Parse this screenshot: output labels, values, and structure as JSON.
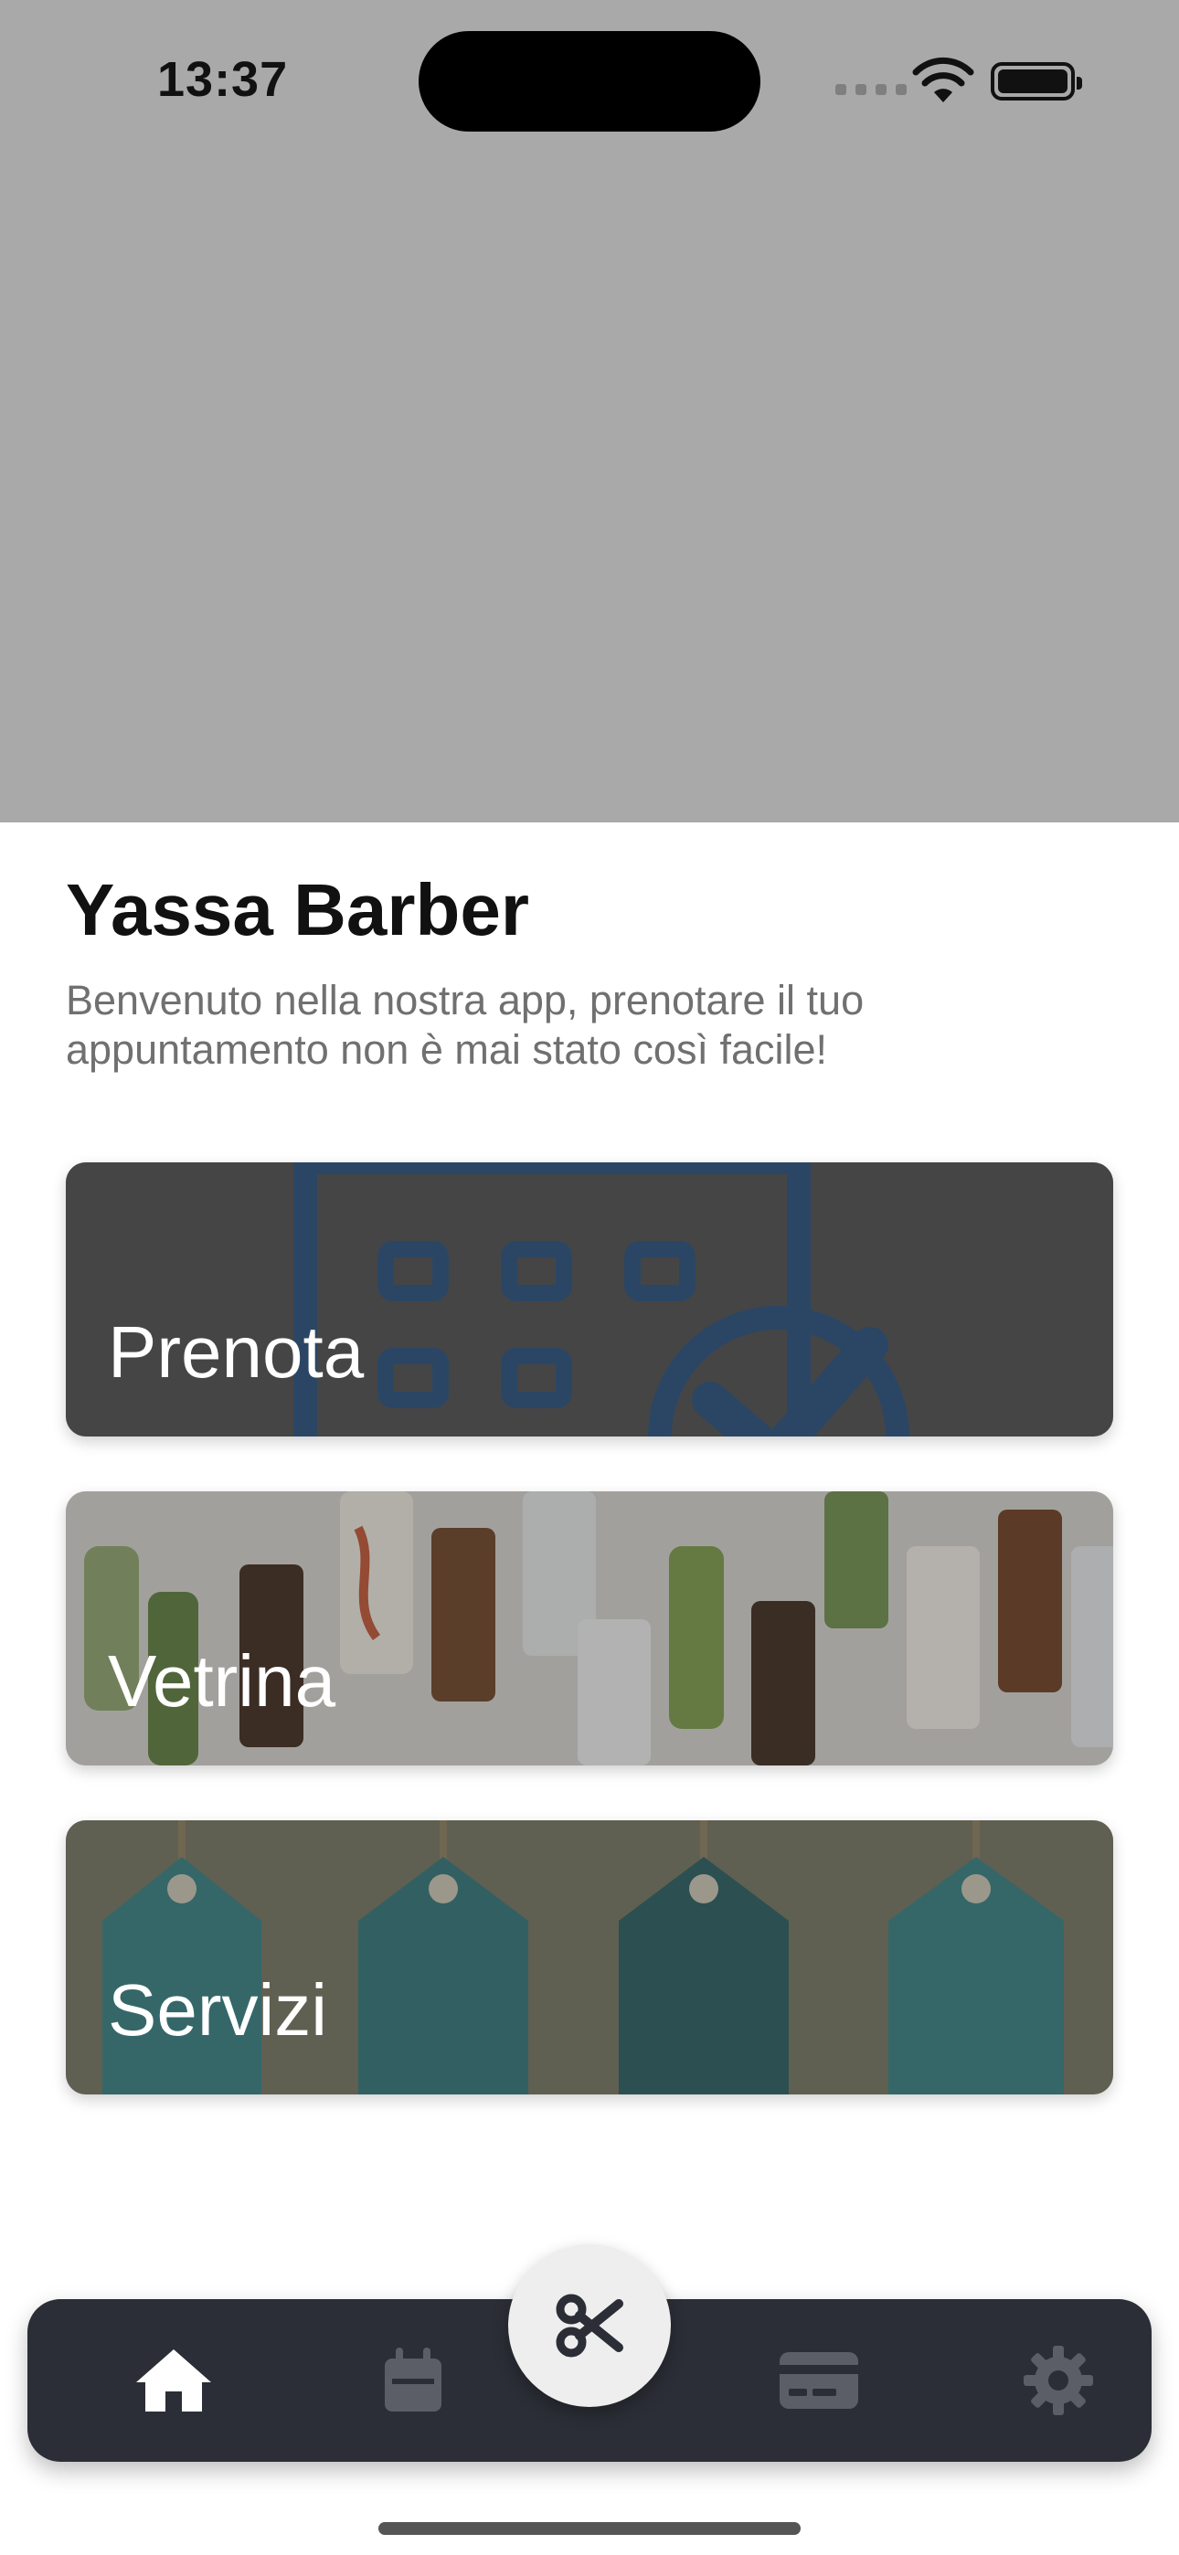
{
  "status_bar": {
    "time": "13:37",
    "icons": [
      "cellular-icon",
      "wifi-icon",
      "battery-icon"
    ]
  },
  "header": {
    "title": "Yassa Barber",
    "subtitle": "Benvenuto nella nostra app, prenotare il tuo appuntamento non è mai stato così facile!"
  },
  "cards": [
    {
      "label": "Prenota",
      "image": "calendar-check-illustration"
    },
    {
      "label": "Vetrina",
      "image": "skincare-products-pattern"
    },
    {
      "label": "Servizi",
      "image": "price-tags-illustration"
    }
  ],
  "tabbar": {
    "items": [
      {
        "icon": "home-icon",
        "active": true
      },
      {
        "icon": "calendar-icon",
        "active": false
      },
      {
        "icon": "scissors-icon",
        "center": true
      },
      {
        "icon": "credit-card-icon",
        "active": false
      },
      {
        "icon": "gear-icon",
        "active": false
      }
    ]
  },
  "colors": {
    "hero_bg": "#a9a9a9",
    "tabbar_bg": "#2b2e36",
    "tab_active": "#ffffff",
    "tab_inactive": "#5b5e66",
    "subtitle": "#707070"
  }
}
